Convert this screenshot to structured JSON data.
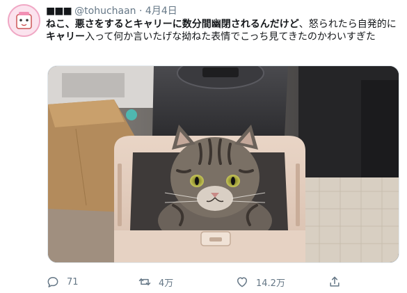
{
  "tweet": {
    "author_name": "■■■",
    "handle": "@tohuchaan",
    "separator": "·",
    "date": "4月4日",
    "text_parts": [
      {
        "t": "ねこ、悪さをするとキャリーに数分間幽閉されるんだけど",
        "bold": true
      },
      {
        "t": "、怒られたら自発的に",
        "bold": false
      },
      {
        "t": "キャリー",
        "bold": true
      },
      {
        "t": "入って何か言いたげな拗ねた表情でこっち見てきたのかわいすぎた",
        "bold": false
      }
    ]
  },
  "media": {
    "description_icon": "cat-in-carrier-photo"
  },
  "actions": {
    "reply_count": "71",
    "retweet_count": "4万",
    "like_count": "14.2万"
  },
  "icons": {
    "reply": "reply-icon",
    "retweet": "retweet-icon",
    "like": "like-icon",
    "share": "share-icon"
  },
  "colors": {
    "muted_text": "#657786",
    "main_text": "#14171a",
    "avatar_ring": "#f0a7c4"
  }
}
